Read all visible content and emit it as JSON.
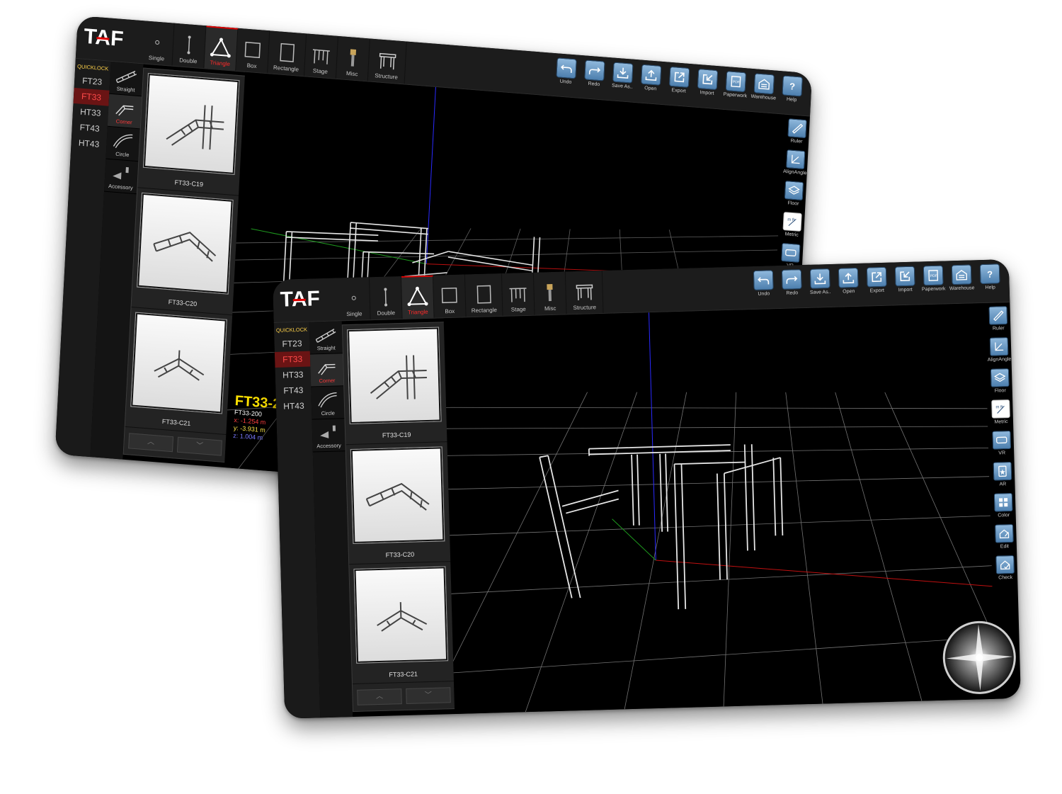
{
  "app": {
    "logo": "TAF"
  },
  "toolbar": {
    "tools": [
      {
        "label": "Single",
        "icon": "single-truss-icon"
      },
      {
        "label": "Double",
        "icon": "double-truss-icon"
      },
      {
        "label": "Triangle",
        "icon": "triangle-truss-icon"
      },
      {
        "label": "Box",
        "icon": "box-truss-icon"
      },
      {
        "label": "Rectangle",
        "icon": "rectangle-truss-icon"
      },
      {
        "label": "Stage",
        "icon": "stage-icon"
      },
      {
        "label": "Misc",
        "icon": "misc-icon"
      },
      {
        "label": "Structure",
        "icon": "structure-icon"
      }
    ],
    "active_tool": "Triangle",
    "actions": [
      {
        "label": "Undo",
        "icon": "undo-icon"
      },
      {
        "label": "Redo",
        "icon": "redo-icon"
      },
      {
        "label": "Save As..",
        "icon": "save-as-icon"
      },
      {
        "label": "Open",
        "icon": "open-icon"
      },
      {
        "label": "Export",
        "icon": "export-icon"
      },
      {
        "label": "Import",
        "icon": "import-icon"
      },
      {
        "label": "Paperwork",
        "icon": "pdf-icon"
      },
      {
        "label": "Warehouse",
        "icon": "warehouse-icon"
      },
      {
        "label": "Help",
        "icon": "help-icon"
      }
    ]
  },
  "sidebar": {
    "quicklock": "QUICKLOCK",
    "series": [
      "FT23",
      "FT33",
      "HT33",
      "FT43",
      "HT43"
    ],
    "active_series": "FT33",
    "categories": [
      {
        "label": "Straight",
        "icon": "straight-truss-icon"
      },
      {
        "label": "Corner",
        "icon": "corner-truss-icon"
      },
      {
        "label": "Circle",
        "icon": "circle-truss-icon"
      },
      {
        "label": "Accessory",
        "icon": "accessory-icon"
      }
    ],
    "active_category": "Corner"
  },
  "items": [
    {
      "name": "FT33-C19"
    },
    {
      "name": "FT33-C20"
    },
    {
      "name": "FT33-C21"
    }
  ],
  "scroll": {
    "up": "︿",
    "down": "﹀"
  },
  "right_tools": [
    {
      "label": "Ruler",
      "icon": "ruler-icon"
    },
    {
      "label": "AlignAngle",
      "icon": "align-angle-icon"
    },
    {
      "label": "Floor",
      "icon": "floor-icon"
    },
    {
      "label": "Metric",
      "icon": "metric-icon",
      "text": "m ft"
    },
    {
      "label": "VR",
      "icon": "vr-icon"
    },
    {
      "label": "AR",
      "icon": "ar-icon"
    },
    {
      "label": "Color",
      "icon": "color-icon"
    },
    {
      "label": "Edit",
      "icon": "edit-icon"
    },
    {
      "label": "Check",
      "icon": "check-icon"
    }
  ],
  "selection": {
    "title": "FT33-2",
    "name": "FT33-200",
    "x": "x: -1.254 m",
    "y": "y: -3.931 m",
    "z": "z: 1.004 m"
  },
  "colors": {
    "accent_red": "#ff2a2a",
    "quicklock_yellow": "#ffd24a",
    "button_blue": "#5f8fbf"
  }
}
